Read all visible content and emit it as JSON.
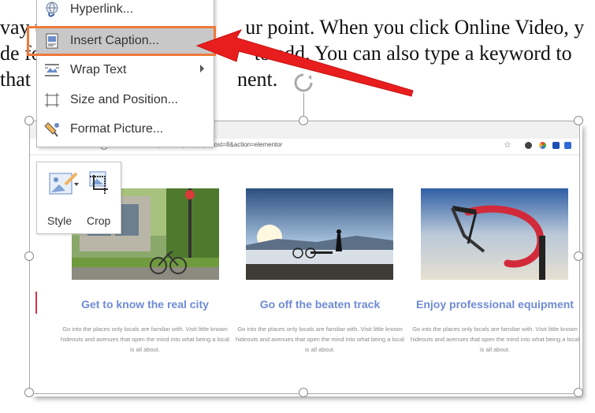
{
  "document": {
    "line1_left": "vay t",
    "line1_right": "ur point. When you click Online Video, y",
    "line2_left": "de fo",
    "line2_right": "to add. You can also type a keyword to",
    "line3_left": "that",
    "line3_right": "nent."
  },
  "context_menu": {
    "items": [
      {
        "label": "Hyperlink...",
        "icon": "hyperlink-icon"
      },
      {
        "label": "Insert Caption...",
        "icon": "insert-caption-icon",
        "highlighted": true
      },
      {
        "label": "Wrap Text",
        "icon": "wrap-text-icon",
        "submenu": true
      },
      {
        "label": "Size and Position...",
        "icon": "size-position-icon"
      },
      {
        "label": "Format Picture...",
        "icon": "format-picture-icon"
      }
    ]
  },
  "mini_toolbar": {
    "style_label": "Style",
    "crop_label": "Crop"
  },
  "browser": {
    "url": "localhost/web1/wp-admin/post.php?post=8&action=elementor"
  },
  "columns": [
    {
      "title": "Get to know the real city",
      "body": "Go into the places only locals are familiar with. Visit little known hideouts and avenues that open the mind into what being a local is all about."
    },
    {
      "title": "Go off the beaten track",
      "body": "Go into the places only locals are familiar with. Visit little known hideouts and avenues that open the mind into what being a local is all about."
    },
    {
      "title": "Enjoy professional equipment",
      "body": "Go into the places only locals are familiar with. Visit little known hideouts and avenues that open the mind into what being a local is all about."
    }
  ],
  "colors": {
    "highlight_border": "#ee7a3a",
    "arrow": "#e81e1e",
    "heading": "#6f8bd5"
  }
}
